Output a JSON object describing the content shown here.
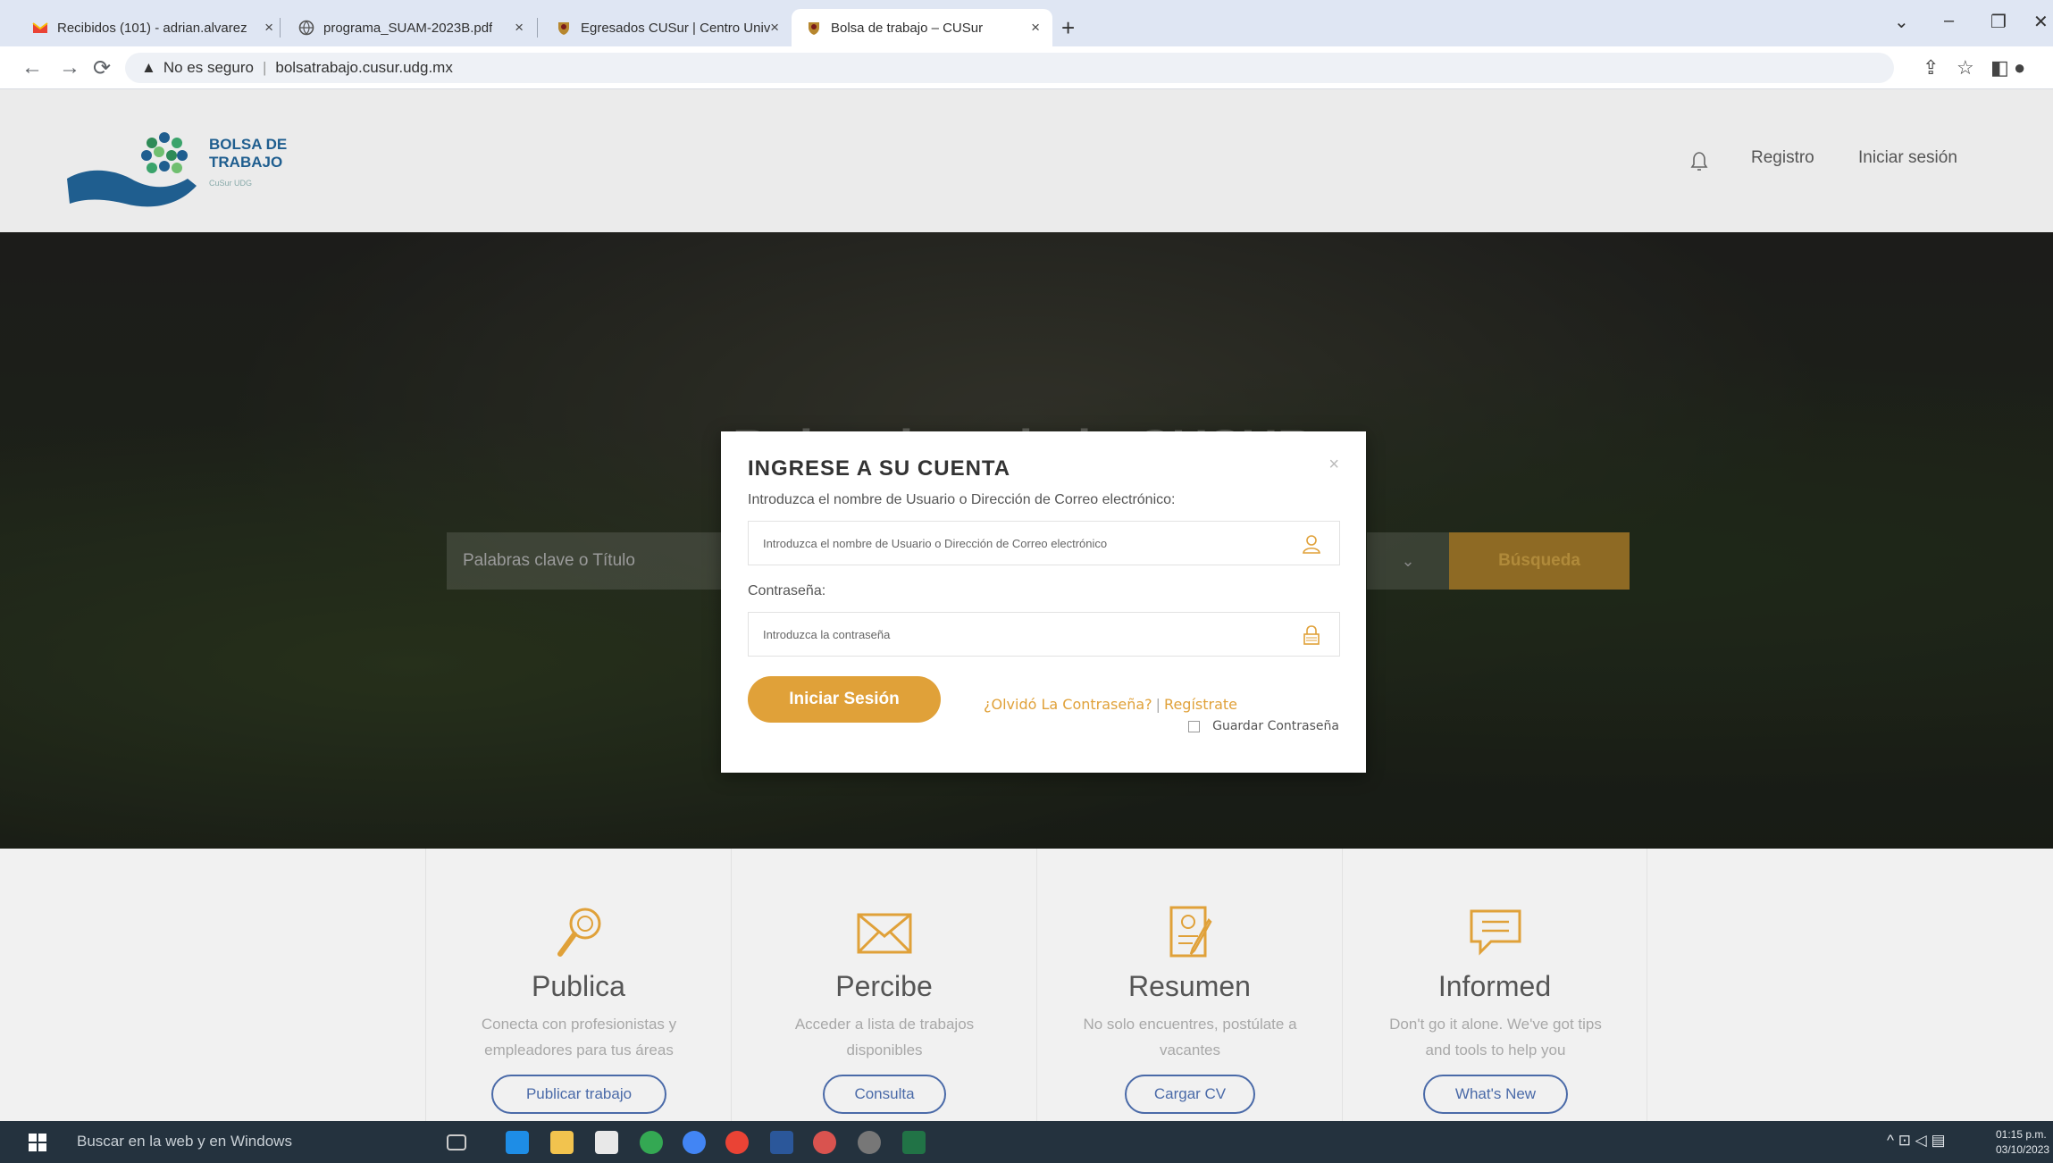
{
  "browser": {
    "tabs": [
      {
        "title": "Recibidos (101) - adrian.alvarez",
        "icon": "gmail-icon"
      },
      {
        "title": "programa_SUAM-2023B.pdf",
        "icon": "globe-icon"
      },
      {
        "title": "Egresados CUSur | Centro Unive",
        "icon": "udg-icon"
      },
      {
        "title": "Bolsa de trabajo – CUSur",
        "icon": "udg-icon",
        "active": true
      }
    ],
    "new_tab": "+",
    "security_label": "No es seguro",
    "url": "bolsatrabajo.cusur.udg.mx"
  },
  "header": {
    "logo_line1": "BOLSA DE",
    "logo_line2": "TRABAJO",
    "logo_sub": "CuSur UDG",
    "register": "Registro",
    "login": "Iniciar sesión"
  },
  "hero": {
    "title": "Bolsa de trabajo CUSUR",
    "keyword_placeholder": "Palabras clave o Título",
    "search_button": "Búsqueda"
  },
  "modal": {
    "title": "INGRESE A SU CUENTA",
    "close": "×",
    "user_label": "Introduzca el nombre de Usuario o Dirección de Correo electrónico:",
    "user_placeholder": "Introduzca el nombre de Usuario o Dirección de Correo electrónico",
    "pass_label": "Contraseña:",
    "pass_placeholder": "Introduzca la contraseña",
    "login_button": "Iniciar Sesión",
    "forgot": "¿Olvidó La Contraseña?",
    "separator": "|",
    "register": "Regístrate",
    "remember": "Guardar Contraseña"
  },
  "features": [
    {
      "title": "Publica",
      "desc": "Conecta con profesionistas y empleadores para tus áreas",
      "button": "Publicar trabajo",
      "icon": "magnifier-icon"
    },
    {
      "title": "Percibe",
      "desc": "Acceder a lista de trabajos disponibles",
      "button": "Consulta",
      "icon": "envelope-icon"
    },
    {
      "title": "Resumen",
      "desc": "No solo encuentres, postúlate a vacantes",
      "button": "Cargar CV",
      "icon": "resume-icon"
    },
    {
      "title": "Informed",
      "desc": "Don't go it alone. We've got tips and tools to help you",
      "button": "What's New",
      "icon": "chat-icon"
    }
  ],
  "taskbar": {
    "search": "Buscar en la web y en Windows",
    "time": "01:15 p.m.",
    "date": "03/10/2023"
  },
  "colors": {
    "accent": "#e0a139",
    "link_blue": "#4a6aa8",
    "logo_blue": "#1f5e8f"
  }
}
